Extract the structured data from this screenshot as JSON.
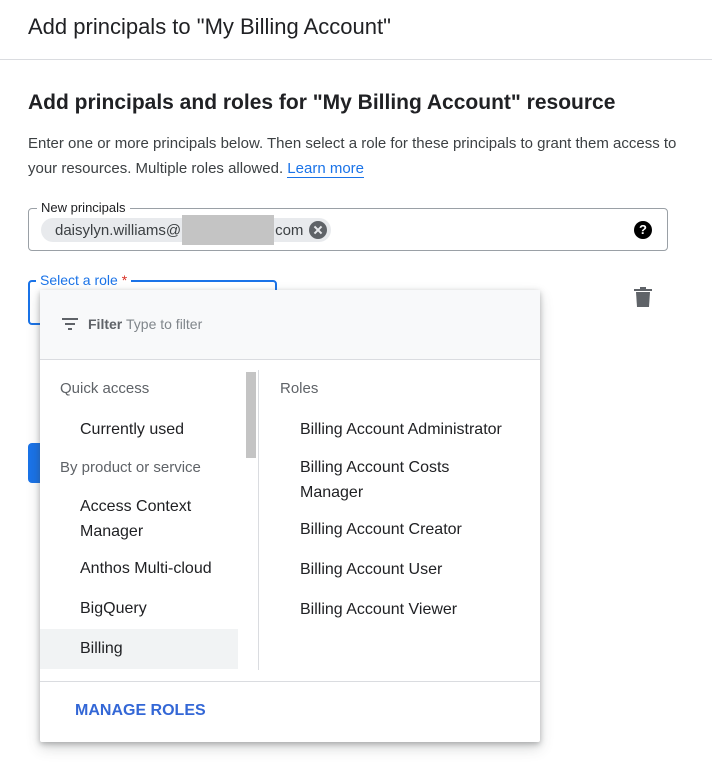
{
  "header": {
    "title": "Add principals to \"My Billing Account\""
  },
  "section": {
    "title": "Add principals and roles for \"My Billing Account\" resource",
    "description": "Enter one or more principals below. Then select a role for these principals to grant them access to your resources. Multiple roles allowed.",
    "learn_more": "Learn more"
  },
  "principals": {
    "label": "New principals",
    "chip_prefix": "daisylyn.williams@",
    "chip_suffix": "com"
  },
  "role": {
    "label": "Select a role",
    "required_mark": "*"
  },
  "dropdown": {
    "filter_label": "Filter",
    "filter_placeholder": "Type to filter",
    "left": {
      "quick_access_header": "Quick access",
      "currently_used": "Currently used",
      "by_product_header": "By product or service",
      "items": [
        "Access Context Manager",
        "Anthos Multi-cloud",
        "BigQuery",
        "Billing"
      ]
    },
    "right": {
      "header": "Roles",
      "items": [
        "Billing Account Administrator",
        "Billing Account Costs Manager",
        "Billing Account Creator",
        "Billing Account User",
        "Billing Account Viewer"
      ]
    },
    "manage_roles": "MANAGE ROLES"
  }
}
